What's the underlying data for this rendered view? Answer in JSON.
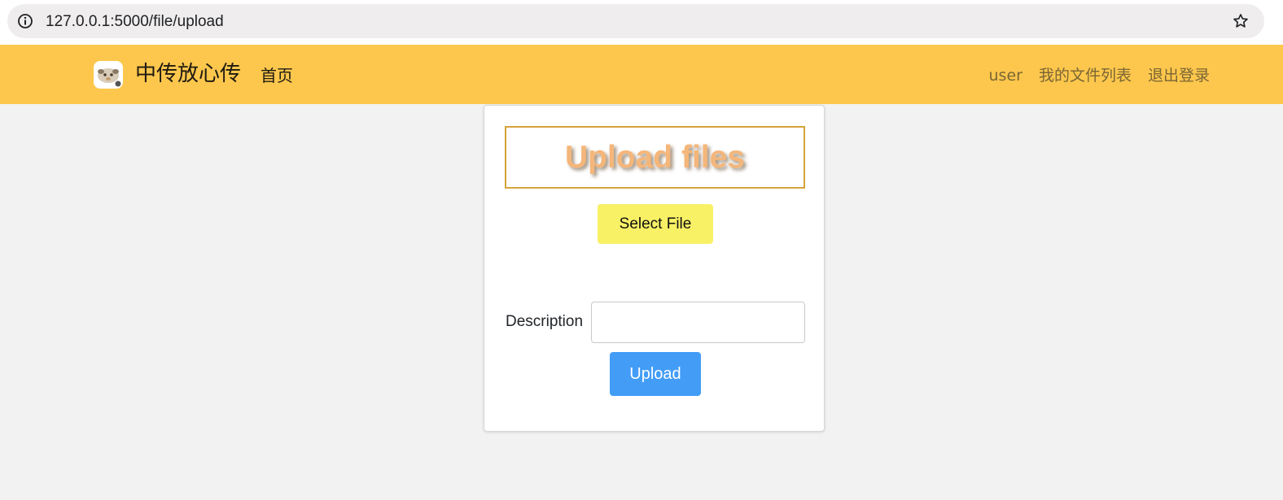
{
  "browser": {
    "url": "127.0.0.1:5000/file/upload",
    "info_icon": "info-icon",
    "star_icon": "star-icon"
  },
  "navbar": {
    "background_color": "#fcc74c",
    "logo_icon": "sheep-logo-icon",
    "brand": "中传放心传",
    "home": "首页",
    "user": "user",
    "my_files": "我的文件列表",
    "logout": "退出登录"
  },
  "upload_card": {
    "title": "Upload files",
    "select_file_label": "Select File",
    "select_file_color": "#f8f165",
    "description_label": "Description",
    "description_value": "",
    "upload_label": "Upload",
    "upload_color": "#439df7"
  }
}
